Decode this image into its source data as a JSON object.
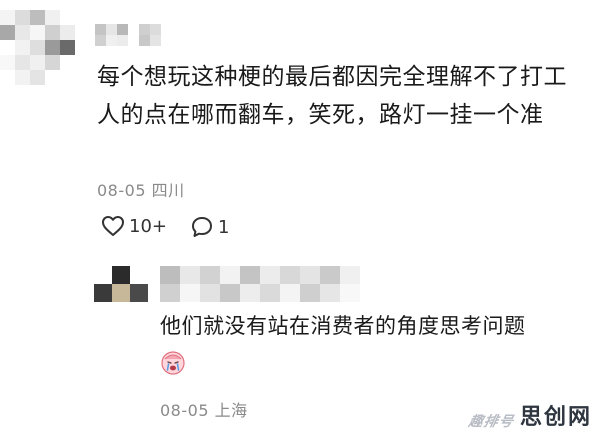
{
  "comment": {
    "text": "每个想玩这种梗的最后都因完全理解不了打工人的点在哪而翻车，笑死，路灯一挂一个准",
    "date": "08-05",
    "location": "四川",
    "likes": "10+",
    "replies": "1",
    "icons": {
      "like": "heart-outline-icon",
      "reply": "speech-bubble-icon"
    }
  },
  "reply": {
    "text": "他们就没有站在消费者的角度思考问题",
    "emoji": "crying-face-sticker",
    "date": "08-05",
    "location": "上海"
  },
  "watermark": {
    "small_text": "趣排号",
    "big_text": "思创网"
  },
  "colors": {
    "text": "#1a1a1a",
    "meta": "#8a8a8a",
    "background": "#ffffff"
  }
}
